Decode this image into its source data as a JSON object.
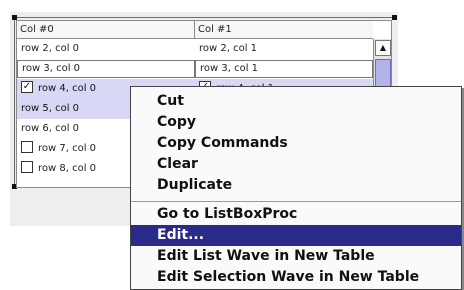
{
  "listbox": {
    "headers": [
      "Col #0",
      "Col #1"
    ],
    "rows": [
      {
        "c0": "row 2, col 0",
        "c1": "row 2, col 1",
        "checkbox": null
      },
      {
        "c0": "row 3, col 0",
        "c1": "row 3, col 1",
        "checkbox": null
      },
      {
        "c0": "row 4, col 0",
        "c1": "row 4, col 1",
        "checkbox": "checked"
      },
      {
        "c0": "row 5, col 0",
        "c1": "",
        "checkbox": null
      },
      {
        "c0": "row 6, col 0",
        "c1": "",
        "checkbox": null
      },
      {
        "c0": "row 7, col 0",
        "c1": "",
        "checkbox": "unchecked"
      },
      {
        "c0": "row 8, col 0",
        "c1": "",
        "checkbox": "unchecked"
      }
    ],
    "scroll_up_glyph": "▲",
    "checkmark_glyph": "✓"
  },
  "context_menu": {
    "group1": [
      "Cut",
      "Copy",
      "Copy Commands",
      "Clear",
      "Duplicate"
    ],
    "group2": [
      "Go to ListBoxProc",
      "Edit...",
      "Edit List Wave in New Table",
      "Edit Selection Wave in New Table"
    ],
    "highlighted": "Edit..."
  },
  "colors": {
    "highlight": "#2a2a8a",
    "selection_row": "#d8d8f6",
    "scroll_thumb": "#b3b3ec"
  }
}
